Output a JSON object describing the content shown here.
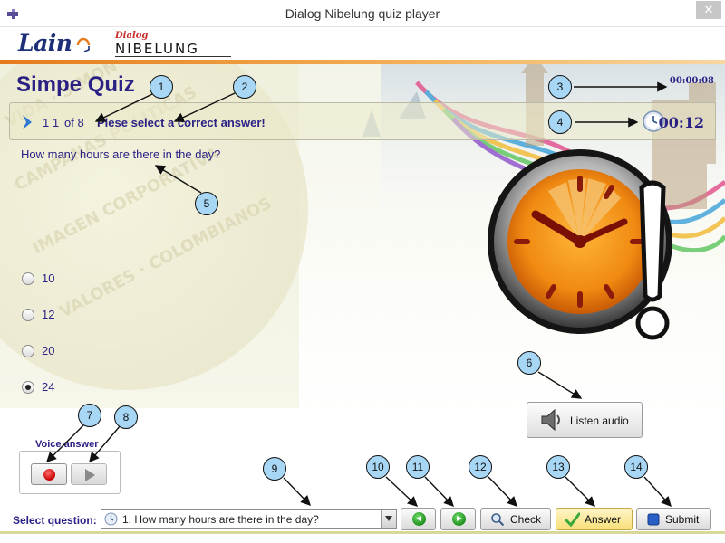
{
  "window": {
    "title": "Dialog Nibelung quiz player",
    "close_label": "✕"
  },
  "logo": {
    "lain": "Lain",
    "dialog": "Dialog",
    "nibelung": "NIBELUNG"
  },
  "quiz": {
    "title": "Simpe Quiz",
    "elapsed_total": "00:00:08",
    "question_number": "1 1",
    "question_of": "of 8",
    "instruction": "Plese select a correct answer!",
    "countdown": "00:12",
    "question_text": "How many hours are there in the day?",
    "options": [
      {
        "label": "10",
        "selected": false
      },
      {
        "label": "12",
        "selected": false
      },
      {
        "label": "20",
        "selected": false
      },
      {
        "label": "24",
        "selected": true
      }
    ]
  },
  "audio": {
    "listen_label": "Listen audio"
  },
  "voice": {
    "label": "Voice answer"
  },
  "toolbar": {
    "select_label": "Select question:",
    "selected_question": "1. How many hours are there in the day?",
    "check_label": "Check",
    "answer_label": "Answer",
    "submit_label": "Submit"
  },
  "callouts": [
    "1",
    "2",
    "3",
    "4",
    "5",
    "6",
    "7",
    "8",
    "9",
    "10",
    "11",
    "12",
    "13",
    "14"
  ],
  "colors": {
    "accent_text": "#2b2185",
    "brand_orange": "#e57b1c",
    "callout_fill": "#a7d7f5",
    "answer_button": "#f8df78"
  },
  "icons": {
    "app": "puzzle-app-icon",
    "chevron": "chevron-right-icon",
    "clock": "clock-icon",
    "alarm": "alarm-clock-exclamation-icon",
    "speaker": "speaker-icon",
    "record": "record-icon",
    "play": "play-icon",
    "prev": "arrow-left-icon",
    "next": "arrow-right-icon",
    "check": "magnifier-icon",
    "answer": "checkmark-icon",
    "submit": "submit-square-icon"
  }
}
